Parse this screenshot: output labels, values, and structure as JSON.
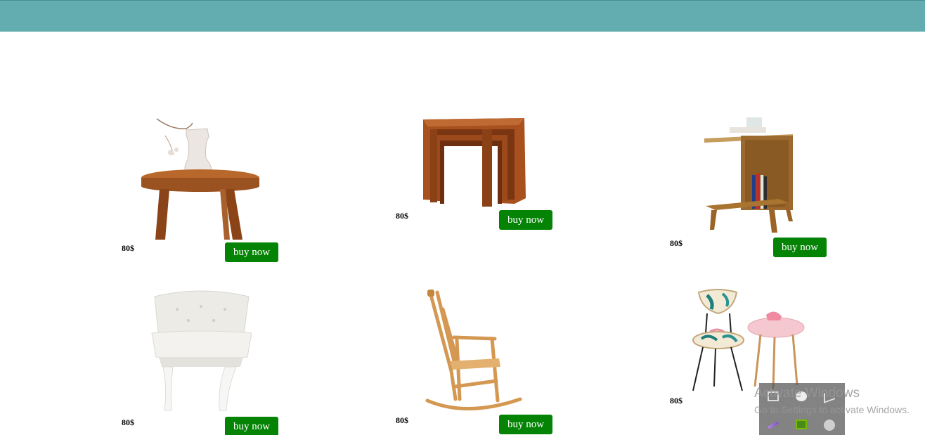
{
  "header": {
    "bar_color": "#63adb0"
  },
  "products": [
    {
      "name": "stool-with-vase",
      "price": "80$",
      "button_label": "buy now"
    },
    {
      "name": "nesting-tables",
      "price": "80$",
      "button_label": "buy now"
    },
    {
      "name": "side-table-with-books",
      "price": "80$",
      "button_label": "buy now"
    },
    {
      "name": "white-tufted-chair",
      "price": "80$",
      "button_label": "buy now"
    },
    {
      "name": "wooden-rocking-chair",
      "price": "80$",
      "button_label": "buy now"
    },
    {
      "name": "leaf-chair-and-pink-table",
      "price": "80$",
      "button_label": "buy now"
    }
  ],
  "overlay": {
    "title": "Activate Windows",
    "subtitle": "Go to Settings to activate Windows."
  },
  "colors": {
    "button": "#048304",
    "button_text": "#ffffff"
  }
}
